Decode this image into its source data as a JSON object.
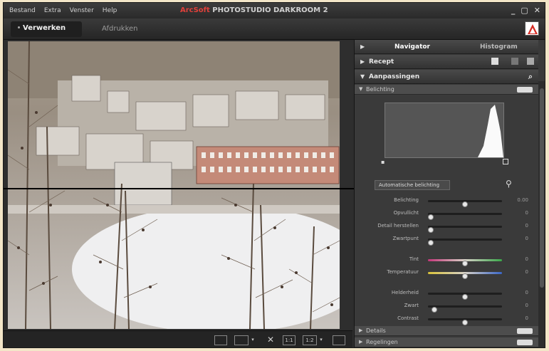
{
  "menubar": {
    "items": [
      "Bestand",
      "Extra",
      "Venster",
      "Help"
    ]
  },
  "app": {
    "brand": "ArcSoft",
    "title": "PHOTOSTUDIO DARKROOM 2"
  },
  "window_controls": [
    "_",
    "▢",
    "✕"
  ],
  "modes": {
    "edit": "Verwerken",
    "print": "Afdrukken"
  },
  "panel": {
    "tabs": {
      "navigator": "Navigator",
      "histogram": "Histogram"
    },
    "recipe_label": "Recept",
    "adjustments_label": "Aanpassingen",
    "exposure_section": "Belichting",
    "auto_button": "Automatische belichting",
    "sliders": [
      {
        "label": "Belichting",
        "value": "0.00",
        "level": 0.5
      },
      {
        "label": "Opvullicht",
        "value": "0",
        "level": 0.0
      },
      {
        "label": "Detail herstellen",
        "value": "0",
        "level": 0.0
      },
      {
        "label": "Zwartpunt",
        "value": "0",
        "level": 0.0
      },
      {
        "label": "Tint",
        "value": "0",
        "level": 0.5
      },
      {
        "label": "Temperatuur",
        "value": "0",
        "level": 0.5
      },
      {
        "label": "Helderheid",
        "value": "0",
        "level": 0.5
      },
      {
        "label": "Zwart",
        "value": "0",
        "level": 0.05
      },
      {
        "label": "Contrast",
        "value": "0",
        "level": 0.5
      }
    ],
    "details_label": "Details",
    "bottom_section": "Regelingen"
  },
  "toolbar": {
    "zoom_label": "1:1",
    "fit_label": "1:2"
  },
  "colors": {
    "accent_red": "#e0403a",
    "panel_bg": "#3a3a3a"
  }
}
